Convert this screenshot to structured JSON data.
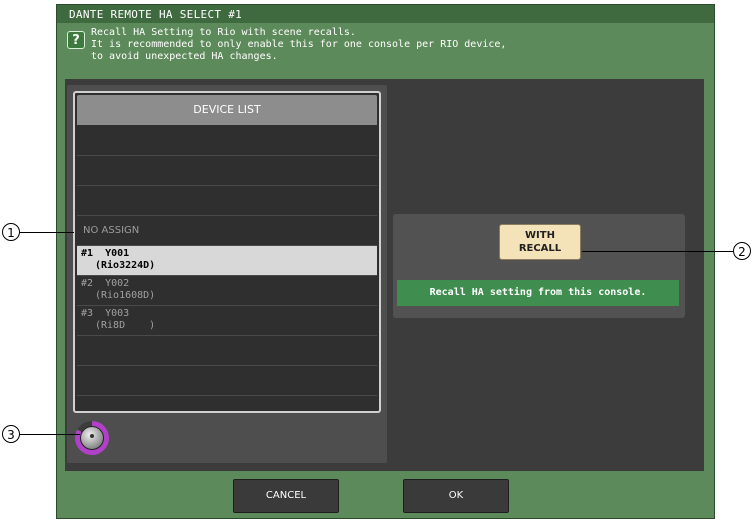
{
  "window": {
    "title": "DANTE REMOTE HA SELECT #1"
  },
  "help": {
    "icon": "?",
    "lines": [
      "Recall HA Setting to Rio with scene recalls.",
      "It is recommended to only enable this for one console per RIO device,",
      "to avoid unexpected HA changes."
    ]
  },
  "device_list": {
    "header": "DEVICE LIST",
    "no_assign": "NO ASSIGN",
    "items": [
      {
        "line1": "#1  Y001",
        "line2": "(Rio3224D)",
        "selected": true
      },
      {
        "line1": "#2  Y002",
        "line2": "(Rio1608D)",
        "selected": false
      },
      {
        "line1": "#3  Y003",
        "line2": "(Ri8D    )",
        "selected": false
      }
    ]
  },
  "recall": {
    "button_line1": "WITH",
    "button_line2": "RECALL",
    "status": "Recall HA setting from this console."
  },
  "buttons": {
    "cancel": "CANCEL",
    "ok": "OK"
  },
  "callouts": {
    "c1": "1",
    "c2": "2",
    "c3": "3"
  },
  "colors": {
    "accent": "#b040c8",
    "status": "#3f8e50",
    "recall_button": "#f4e2b8"
  }
}
